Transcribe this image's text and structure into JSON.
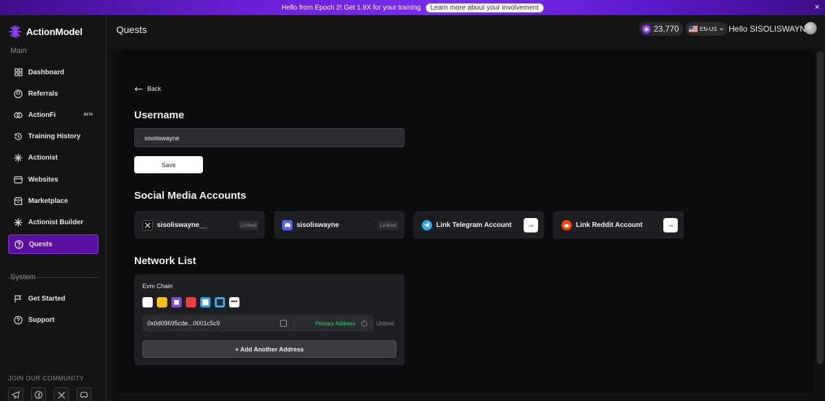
{
  "banner": {
    "text": "Hello from Epoch 2! Get 1.9X for your training",
    "link": "Learn more about your involvement",
    "close": "×"
  },
  "brand": {
    "name": "ActionModel"
  },
  "sidebar": {
    "main_label": "Main",
    "items": [
      {
        "label": "Dashboard",
        "icon": "grid-icon"
      },
      {
        "label": "Referrals",
        "icon": "users-icon"
      },
      {
        "label": "ActionFi",
        "icon": "actionfi-icon",
        "badge": "BETA"
      },
      {
        "label": "Training History",
        "icon": "history-icon"
      },
      {
        "label": "Actionist",
        "icon": "sparkle-icon"
      },
      {
        "label": "Websites",
        "icon": "browser-icon"
      },
      {
        "label": "Marketplace",
        "icon": "store-icon"
      },
      {
        "label": "Actionist Builder",
        "icon": "builder-icon"
      },
      {
        "label": "Quests",
        "icon": "question-icon",
        "active": true
      }
    ],
    "system_label": "System",
    "system_items": [
      {
        "label": "Get Started",
        "icon": "flag-icon"
      },
      {
        "label": "Support",
        "icon": "help-icon"
      }
    ],
    "community_label": "JOIN OUR COMMUNITY",
    "community_icons": [
      "telegram-icon",
      "facebook-icon",
      "x-icon",
      "discord-icon"
    ]
  },
  "header": {
    "title": "Quests",
    "points": "23,770",
    "language": "EN-US",
    "greeting": "Hello SISOLISWAYNE"
  },
  "profile": {
    "back_label": "Back",
    "username_heading": "Username",
    "username_value": "sisoliswayne",
    "save_label": "Save",
    "social_heading": "Social Media Accounts",
    "socials": [
      {
        "platform": "x",
        "label": "sisoliswayne__",
        "status": "Linked",
        "icon_color": "#000000"
      },
      {
        "platform": "discord",
        "label": "sisoliswayne",
        "status": "Linked",
        "icon_color": "#5865F2"
      },
      {
        "platform": "telegram",
        "label": "Link Telegram Account",
        "icon_color": "#2AABEE"
      },
      {
        "platform": "reddit",
        "label": "Link Reddit Account",
        "icon_color": "#FF4500"
      }
    ],
    "network_heading": "Network List",
    "network": {
      "chain_label": "Evm Chain",
      "chain_icons": [
        "ethereum-icon",
        "bnb-icon",
        "polygon-icon",
        "avalanche-icon",
        "arbitrum-icon",
        "base-icon",
        "more-icon"
      ],
      "address": "0x0d09695cde...0001c5c9",
      "primary_label": "Primary Address",
      "unbind_label": "Unbind",
      "add_label": "+ Add Another Address"
    }
  },
  "colors": {
    "accent": "#5a0fa0",
    "primary_green": "#2fd37a"
  }
}
